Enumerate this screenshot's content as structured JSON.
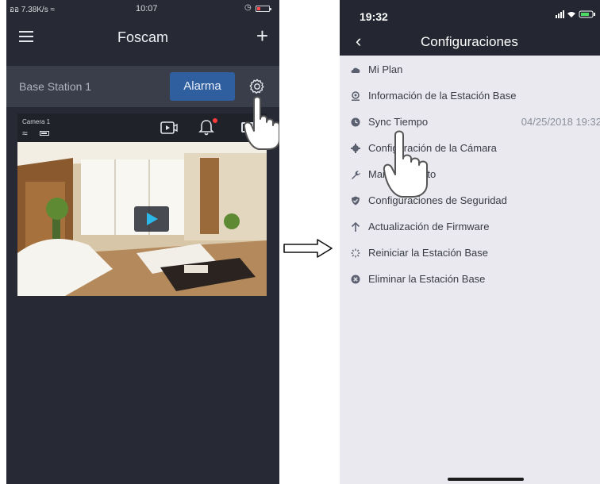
{
  "left_phone": {
    "status_bar": {
      "signal": "ออ 7.38K/s ≈",
      "time": "10:07"
    },
    "header": {
      "title": "Foscam",
      "add_label": "+"
    },
    "base_station": {
      "name": "Base Station 1",
      "alarm_button": "Alarma"
    },
    "camera": {
      "name": "Camera 1"
    },
    "colors": {
      "background": "#272a34",
      "alarm_button": "#2f5f9e",
      "notification_dot": "#ff3b3b",
      "play": "#2bb7e8"
    }
  },
  "right_phone": {
    "status_bar": {
      "time": "19:32"
    },
    "header": {
      "title": "Configuraciones"
    },
    "menu": [
      {
        "icon": "cloud-icon",
        "label": "Mi Plan"
      },
      {
        "icon": "info-pin-icon",
        "label": "Información de la Estación Base"
      },
      {
        "icon": "clock-icon",
        "label": "Sync Tiempo",
        "value": "04/25/2018 19:32"
      },
      {
        "icon": "gear-icon",
        "label": "Configuración de la Cámara"
      },
      {
        "icon": "wrench-icon",
        "label": "Mantenimiento"
      },
      {
        "icon": "shield-icon",
        "label": "Configuraciones de Seguridad"
      },
      {
        "icon": "upload-arrow-icon",
        "label": "Actualización de Firmware"
      },
      {
        "icon": "restart-spinner-icon",
        "label": "Reiniciar la Estación Base"
      },
      {
        "icon": "delete-x-icon",
        "label": "Eliminar la Estación Base"
      }
    ]
  }
}
